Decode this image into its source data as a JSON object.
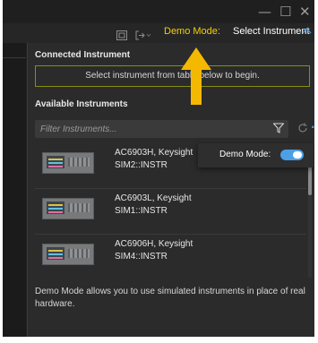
{
  "window": {
    "minimize_glyph": "—",
    "maximize_glyph": "☐",
    "close_glyph": "✕"
  },
  "toolbar": {
    "demo_mode_label": "Demo Mode:",
    "select_instrument_label": "Select Instrument",
    "select_instrument_chevron": "^",
    "icons": [
      "panel-icon",
      "export-icon"
    ]
  },
  "connected": {
    "title": "Connected Instrument",
    "message": "Select instrument from table below to begin."
  },
  "available": {
    "title": "Available Instruments",
    "filter_placeholder": "Filter Instruments...",
    "items": [
      {
        "name": "AC6903H, Keysight",
        "address": "SIM2::INSTR"
      },
      {
        "name": "AC6903L, Keysight",
        "address": "SIM1::INSTR"
      },
      {
        "name": "AC6906H, Keysight",
        "address": "SIM4::INSTR"
      }
    ]
  },
  "demo_popup": {
    "label": "Demo Mode:",
    "toggle_on": true
  },
  "footer": {
    "note": "Demo Mode allows you to use simulated instruments in place of real hardware."
  },
  "colors": {
    "accent": "#4d9fe6",
    "demo_yellow": "#f5d000",
    "callout_arrow": "#f5b800",
    "connected_border": "#8a8c10"
  }
}
